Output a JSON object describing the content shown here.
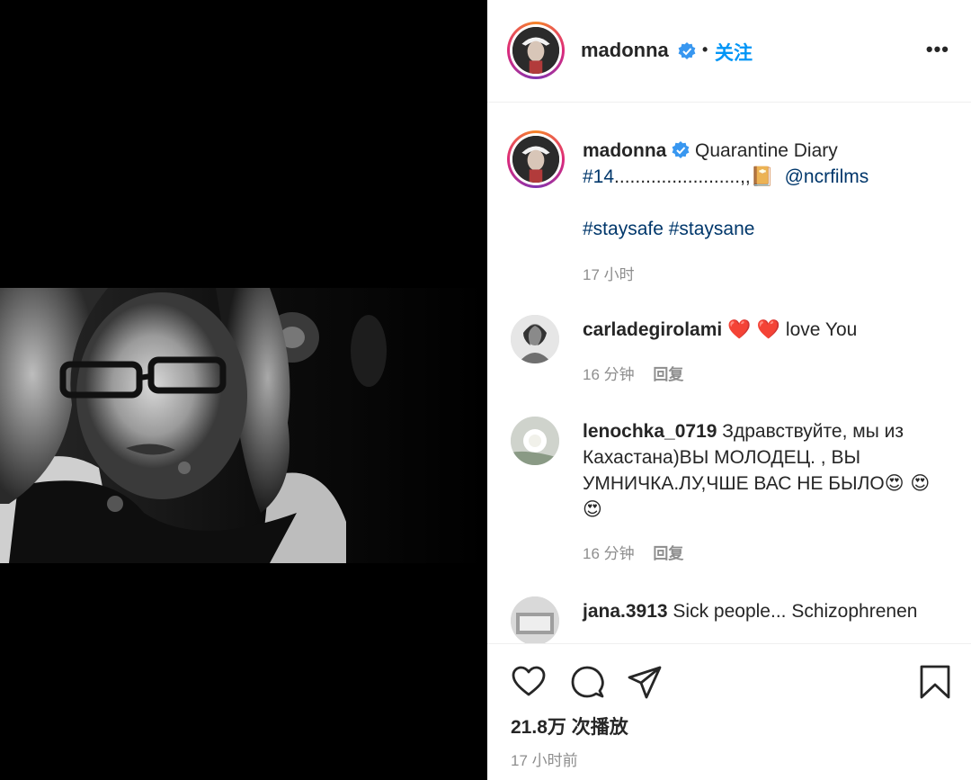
{
  "header": {
    "username": "madonna",
    "separator": "•",
    "follow_label": "关注",
    "more_label": "•••"
  },
  "caption": {
    "username": "madonna",
    "text_1": "Quarantine Diary",
    "hashtag_1": "#14",
    "text_2": "........................,,",
    "emoji_book": "📔",
    "mention": "@ncrfilms",
    "hashtag_2": "#staysafe",
    "hashtag_3": "#staysane",
    "time": "17 小时"
  },
  "comments": [
    {
      "username": "carladegirolami",
      "hearts": "❤️ ❤️",
      "text": "love You",
      "time": "16 分钟",
      "reply_label": "回复"
    },
    {
      "username": "lenochka_0719",
      "text": "Здравствуйте, мы из Кахастана)ВЫ МОЛОДЕЦ. , ВЫ УМНИЧКА.ЛУ,ЧШЕ ВАС НЕ БЫЛО",
      "emojis": "😍 😍 😍",
      "time": "16 分钟",
      "reply_label": "回复"
    },
    {
      "username": "jana.3913",
      "text": "Sick people... Schizophrenen"
    }
  ],
  "footer": {
    "views": "21.8万 次播放",
    "posted": "17 小时前"
  },
  "icons": {
    "like": "heart-icon",
    "comment": "comment-bubble-icon",
    "share": "paper-plane-icon",
    "save": "bookmark-icon",
    "verified": "verified-badge-icon"
  },
  "colors": {
    "accent": "#0095f6",
    "link": "#00376b",
    "muted": "#8e8e8e",
    "verified": "#3897f0"
  }
}
